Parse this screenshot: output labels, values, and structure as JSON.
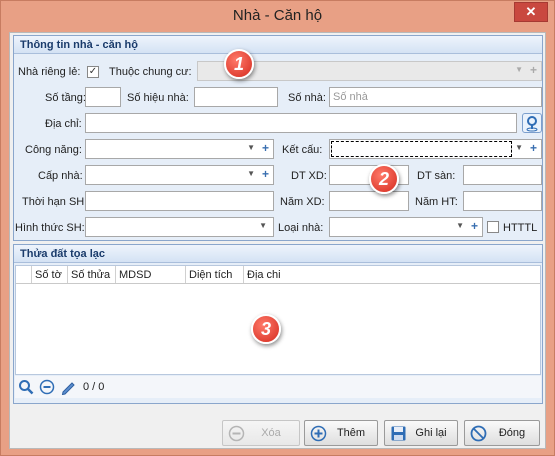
{
  "window": {
    "title": "Nhà - Căn hộ",
    "close": "✕"
  },
  "info": {
    "header": "Thông tin nhà - căn hộ",
    "nha_rieng_le": "Nhà riêng lẻ:",
    "thuoc_chung_cu": "Thuộc chung cư:",
    "so_tang": "Số tầng:",
    "so_hieu_nha": "Số hiệu nhà:",
    "so_nha": "Số nhà:",
    "so_nha_placeholder": "Số nhà",
    "dia_chi": "Địa chỉ:",
    "cong_nang": "Công năng:",
    "ket_cau": "Kết cấu:",
    "cap_nha": "Cấp nhà:",
    "dt_xd": "DT XD:",
    "dt_san": "DT sàn:",
    "thoi_han_sh": "Thời hạn SH:",
    "nam_xd": "Năm XD:",
    "nam_ht": "Năm HT:",
    "hinh_thuc_sh": "Hình thức SH:",
    "loai_nha": "Loại nhà:",
    "htttl": "HTTTL"
  },
  "parcel": {
    "header": "Thửa đất tọa lạc",
    "columns": [
      "Số tờ",
      "Số thửa",
      "MDSD",
      "Diện tích",
      "Địa chi"
    ],
    "record_count": "0 / 0"
  },
  "badges": {
    "one": "1",
    "two": "2",
    "three": "3"
  },
  "buttons": {
    "delete": "Xóa",
    "add": "Thêm",
    "save": "Ghi lại",
    "close": "Đóng"
  }
}
